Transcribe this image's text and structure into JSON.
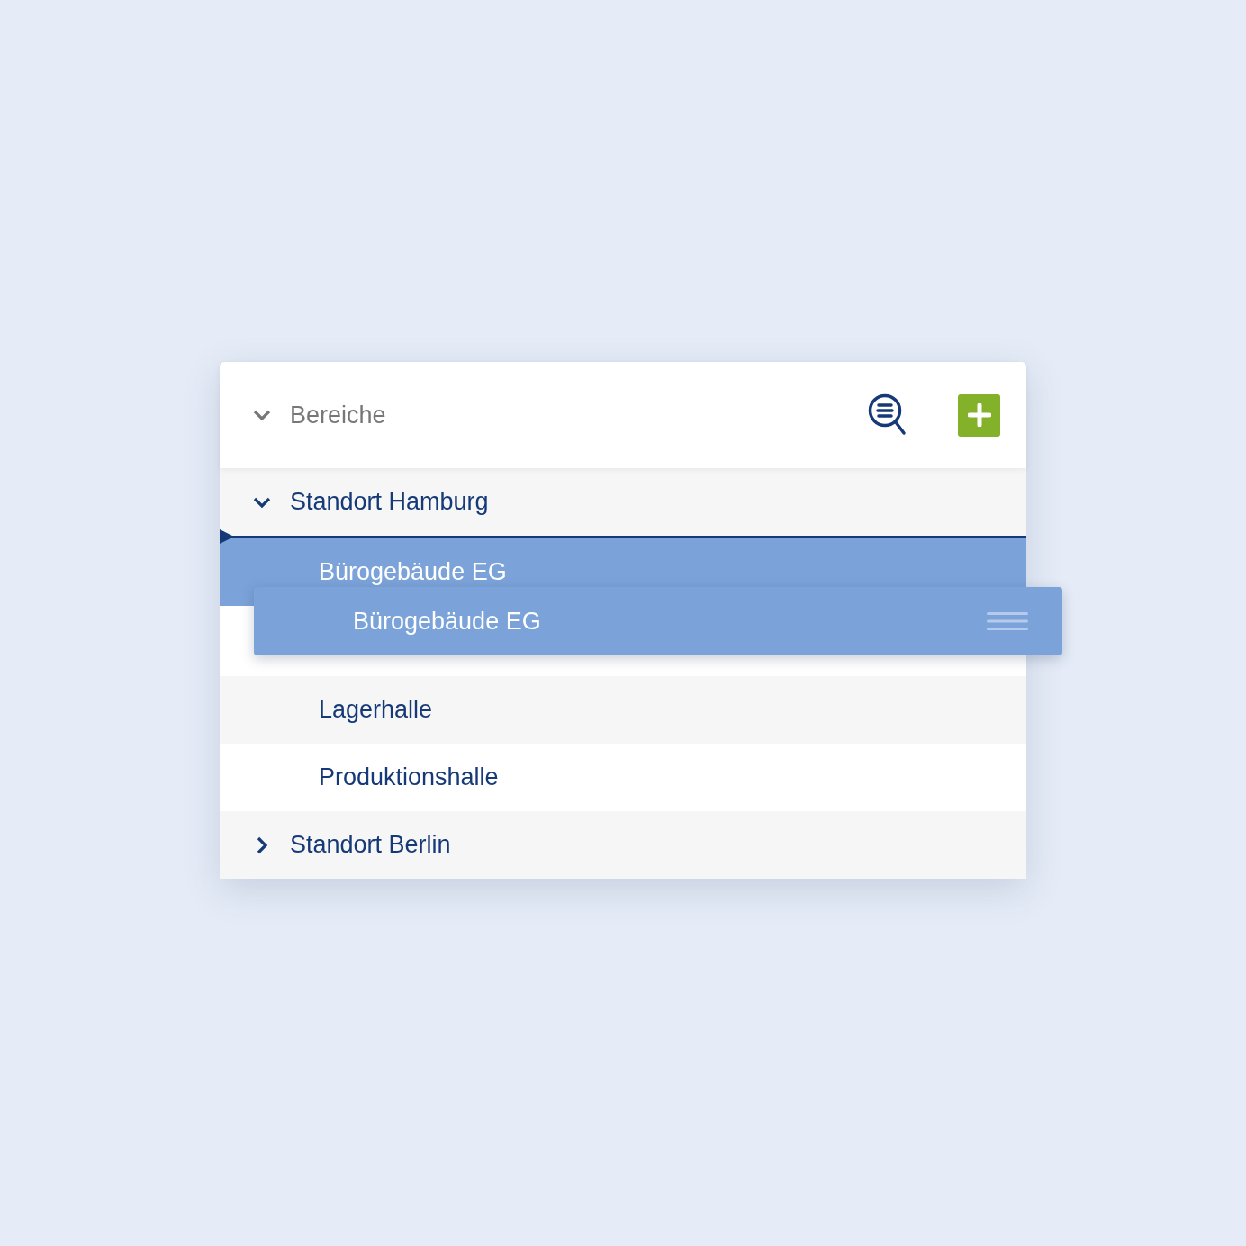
{
  "header": {
    "title": "Bereiche",
    "expanded": true
  },
  "tree": [
    {
      "label": "Standort Hamburg",
      "expanded": true,
      "selected": false,
      "children": [
        {
          "label": "Bürogebäude EG",
          "selected": true,
          "drop_target": true
        },
        {
          "label": "Lagerhalle",
          "selected": false,
          "drop_target": false
        },
        {
          "label": "Produktionshalle",
          "selected": false,
          "drop_target": false
        }
      ]
    },
    {
      "label": "Standort Berlin",
      "expanded": false,
      "selected": false
    }
  ],
  "drag_preview": {
    "label": "Bürogebäude EG"
  }
}
